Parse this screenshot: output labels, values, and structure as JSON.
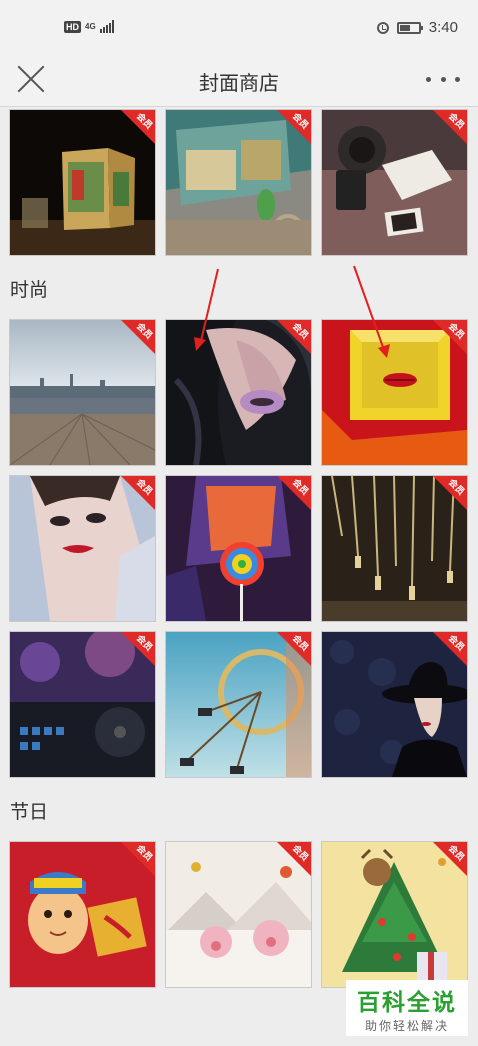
{
  "status_bar": {
    "hd": "HD",
    "network": "4G",
    "time": "3:40"
  },
  "header": {
    "title": "封面商店"
  },
  "sections": [
    {
      "title": "时尚"
    },
    {
      "title": "节日"
    }
  ],
  "badge_label": "会员",
  "watermark": {
    "main": "百科全说",
    "sub": "助你轻松解决"
  },
  "colors": {
    "badge": "#e02a28",
    "arrow": "#e0201c",
    "watermark": "#2aa030"
  }
}
